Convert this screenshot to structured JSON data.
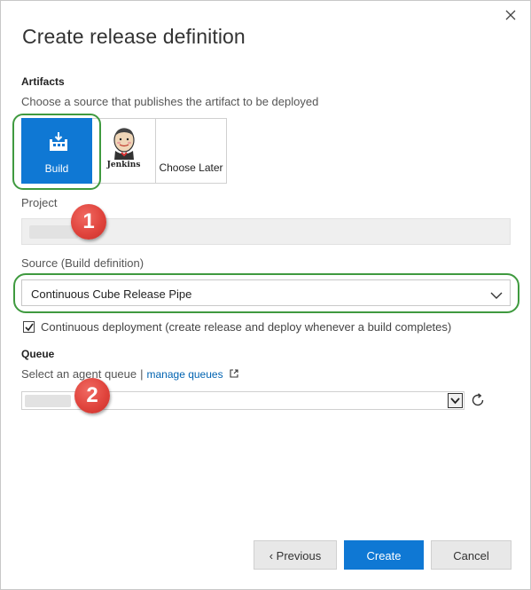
{
  "dialog": {
    "title": "Create release definition",
    "close_icon": "close-icon"
  },
  "artifacts": {
    "label": "Artifacts",
    "hint": "Choose a source that publishes the artifact to be deployed",
    "tiles": [
      {
        "label": "Build",
        "icon": "build-icon",
        "selected": true
      },
      {
        "label": "Jenkins",
        "icon": "jenkins-icon",
        "selected": false
      },
      {
        "label": "Choose Later",
        "icon": "",
        "selected": false
      }
    ]
  },
  "project": {
    "label": "Project",
    "value": ""
  },
  "source": {
    "label": "Source (Build definition)",
    "value": "Continuous Cube Release Pipe"
  },
  "continuous_deployment": {
    "checked": true,
    "label": "Continuous deployment (create release and deploy whenever a build completes)"
  },
  "queue": {
    "label": "Queue",
    "hint": "Select an agent queue",
    "separator": "|",
    "manage_link": "manage queues",
    "value": ""
  },
  "badges": [
    "1",
    "2"
  ],
  "buttons": {
    "previous": "‹ Previous",
    "create": "Create",
    "cancel": "Cancel"
  },
  "colors": {
    "accent": "#0f78d4",
    "highlight": "#3f9a3f",
    "badge": "#e0443d",
    "link": "#0063b1"
  }
}
